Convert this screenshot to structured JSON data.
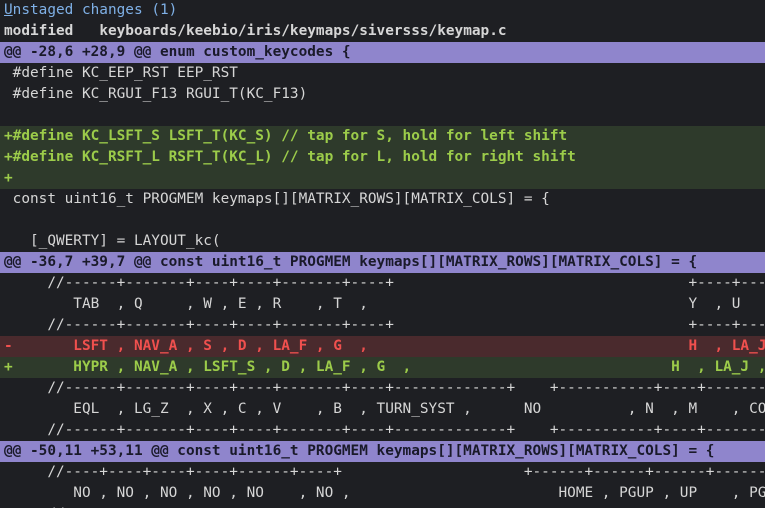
{
  "header": {
    "title_first": "U",
    "title_rest": "nstaged changes",
    "count": "(1)",
    "modified_label": "modified",
    "file_path": "keyboards/keebio/iris/keymaps/siversss/keymap.c"
  },
  "lines": [
    {
      "type": "hunk",
      "text": "@@ -28,6 +28,9 @@ enum custom_keycodes {"
    },
    {
      "type": "ctx",
      "text": " #define KC_EEP_RST EEP_RST"
    },
    {
      "type": "ctx",
      "text": " #define KC_RGUI_F13 RGUI_T(KC_F13)"
    },
    {
      "type": "ctx",
      "text": ""
    },
    {
      "type": "add",
      "text": "+#define KC_LSFT_S LSFT_T(KC_S) // tap for S, hold for left shift"
    },
    {
      "type": "add",
      "text": "+#define KC_RSFT_L RSFT_T(KC_L) // tap for L, hold for right shift"
    },
    {
      "type": "add",
      "text": "+"
    },
    {
      "type": "ctx",
      "text": " const uint16_t PROGMEM keymaps[][MATRIX_ROWS][MATRIX_COLS] = {"
    },
    {
      "type": "ctx",
      "text": ""
    },
    {
      "type": "ctx",
      "text": "   [_QWERTY] = LAYOUT_kc("
    },
    {
      "type": "hunk",
      "text": "@@ -36,7 +39,7 @@ const uint16_t PROGMEM keymaps[][MATRIX_ROWS][MATRIX_COLS] = {"
    },
    {
      "type": "ctx",
      "text": "     //------+-------+----+----+-------+----+                                  +----+-------+-----"
    },
    {
      "type": "ctx",
      "text": "        TAB  , Q     , W , E , R    , T  ,                                     Y  , U    , I"
    },
    {
      "type": "ctx",
      "text": "     //------+-------+----+----+-------+----+                                  +----+-------+-----"
    },
    {
      "type": "del",
      "text": "-       LSFT , NAV_A , S , D , LA_F , G  ,                                     H  , LA_J , K"
    },
    {
      "type": "add",
      "text": "+       HYPR , NAV_A , LSFT_S , D , LA_F , G  ,                              H  , LA_J , K"
    },
    {
      "type": "ctx",
      "text": "     //------+-------+----+----+-------+----+-------------+    +-----------+----+-------+-----"
    },
    {
      "type": "ctx",
      "text": "        EQL  , LG_Z  , X , C , V    , B  , TURN_SYST ,      NO          , N  , M    , CO"
    },
    {
      "type": "ctx",
      "text": "     //------+-------+----+----+-------+----+-------------+    +-----------+----+-------+-----"
    },
    {
      "type": "hunk",
      "text": "@@ -50,11 +53,11 @@ const uint16_t PROGMEM keymaps[][MATRIX_ROWS][MATRIX_COLS] = {"
    },
    {
      "type": "ctx",
      "text": "     //----+----+----+----+------+----+                     +------+------+------+------+--"
    },
    {
      "type": "ctx",
      "text": "        NO , NO , NO , NO , NO    , NO ,                        HOME , PGUP , UP    , PGDN ,"
    },
    {
      "type": "ctx",
      "text": "     //"
    }
  ]
}
